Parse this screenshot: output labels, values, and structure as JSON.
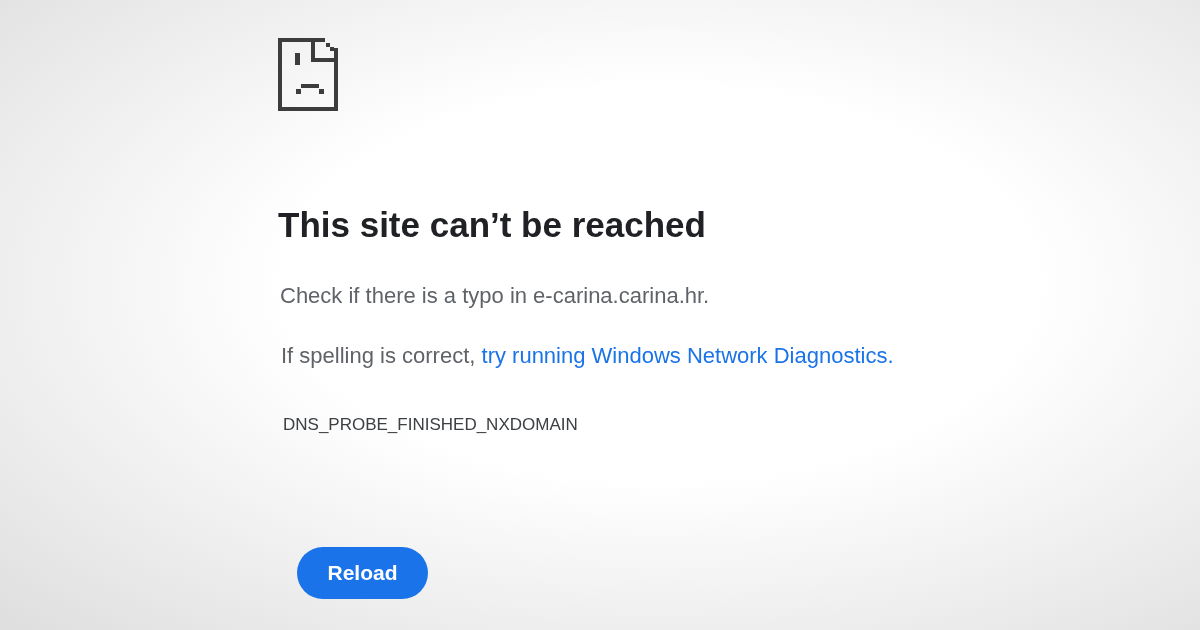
{
  "title": "This site can’t be reached",
  "message": "Check if there is a typo in e-carina.carina.hr.",
  "suggestion": {
    "text": "If spelling is correct, ",
    "link": "try running Windows Network Diagnostics."
  },
  "error_code": "DNS_PROBE_FINISHED_NXDOMAIN",
  "reload_button": {
    "label": "Reload"
  }
}
